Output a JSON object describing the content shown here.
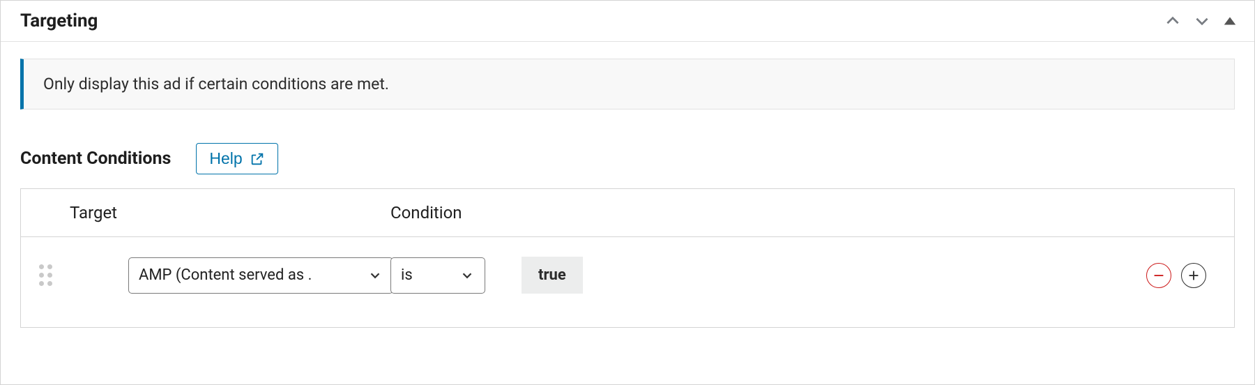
{
  "panel": {
    "title": "Targeting",
    "notice": "Only display this ad if certain conditions are met."
  },
  "conditions": {
    "section_title": "Content Conditions",
    "help_label": "Help",
    "table": {
      "headers": {
        "target": "Target",
        "condition": "Condition"
      },
      "rows": [
        {
          "target_select": "AMP (Content served as .",
          "condition_select": "is",
          "value_chip": "true"
        }
      ]
    }
  }
}
